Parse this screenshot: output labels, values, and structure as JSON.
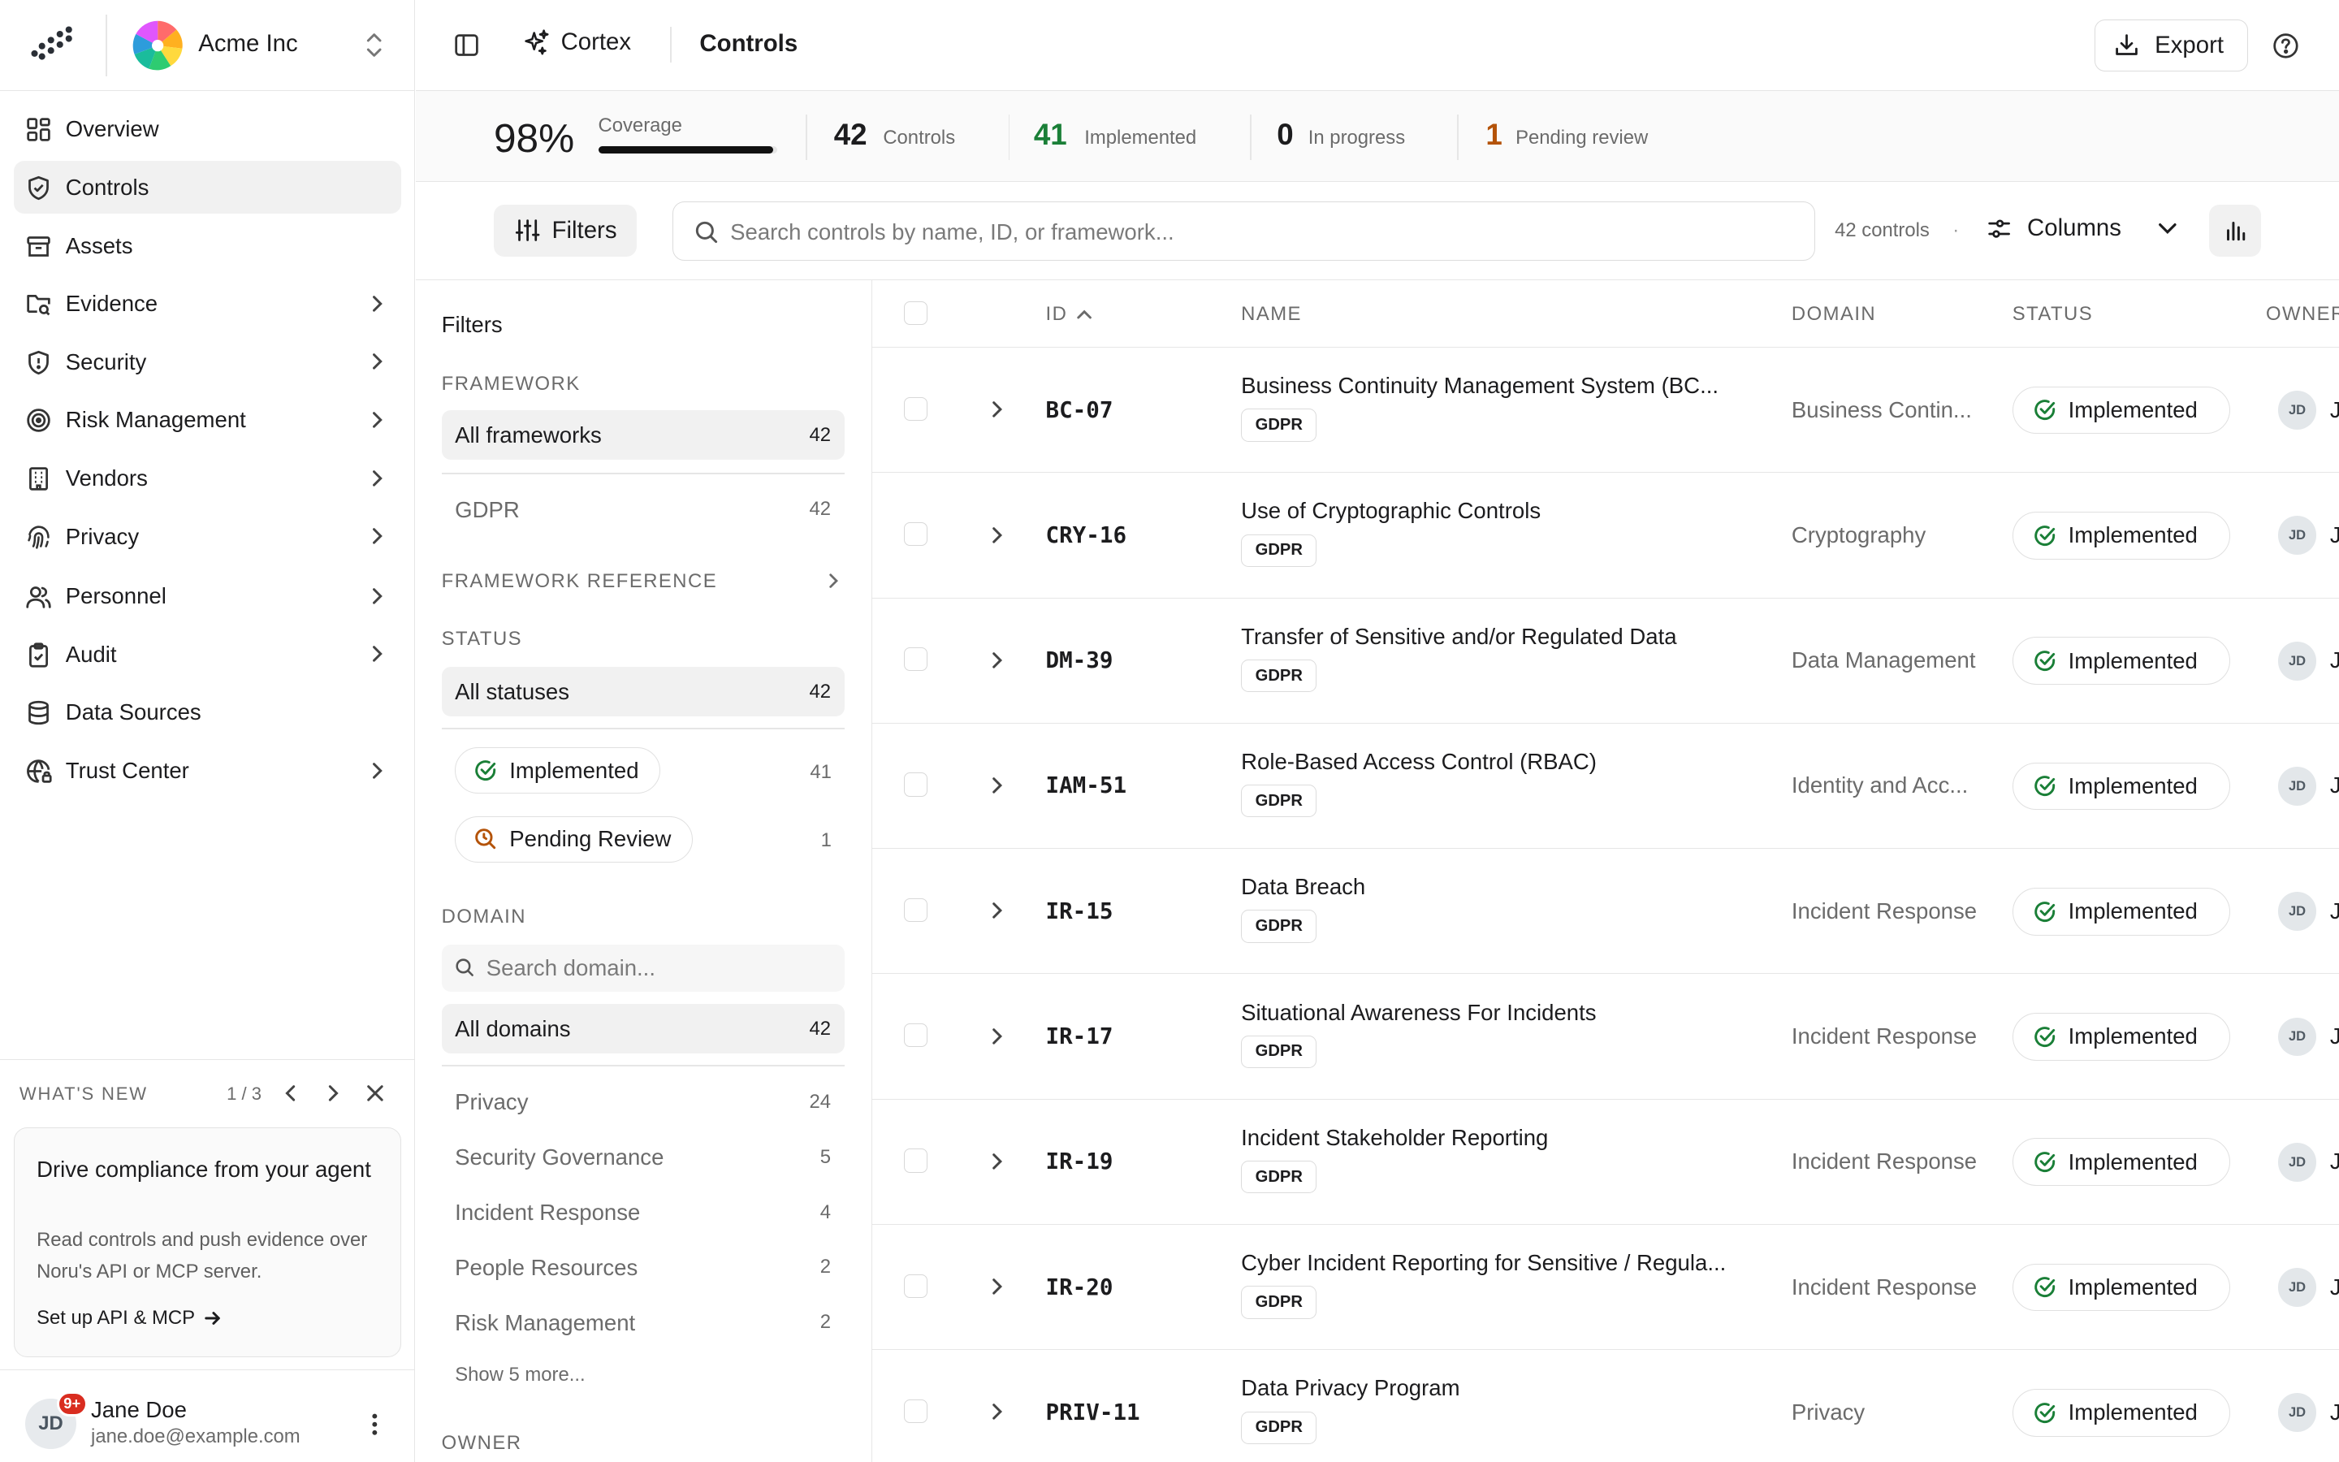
{
  "app": {
    "org_name": "Acme Inc",
    "assistant_label": "Cortex",
    "page_title": "Controls",
    "export_label": "Export",
    "accent_color": "#1a7f37",
    "pending_color": "#b45309"
  },
  "sidebar": {
    "items": [
      {
        "label": "Overview",
        "icon": "grid-icon",
        "has_children": false
      },
      {
        "label": "Controls",
        "icon": "shield-check-icon",
        "has_children": false,
        "active": true
      },
      {
        "label": "Assets",
        "icon": "archive-icon",
        "has_children": false
      },
      {
        "label": "Evidence",
        "icon": "folder-search-icon",
        "has_children": true
      },
      {
        "label": "Security",
        "icon": "shield-icon",
        "has_children": true
      },
      {
        "label": "Risk Management",
        "icon": "target-icon",
        "has_children": true
      },
      {
        "label": "Vendors",
        "icon": "building-icon",
        "has_children": true
      },
      {
        "label": "Privacy",
        "icon": "fingerprint-icon",
        "has_children": true
      },
      {
        "label": "Personnel",
        "icon": "users-icon",
        "has_children": true
      },
      {
        "label": "Audit",
        "icon": "clipboard-check-icon",
        "has_children": true
      },
      {
        "label": "Data Sources",
        "icon": "database-icon",
        "has_children": false
      },
      {
        "label": "Trust Center",
        "icon": "globe-lock-icon",
        "has_children": true
      }
    ],
    "whats_new": {
      "title": "WHAT'S NEW",
      "pager": "1 / 3",
      "card_title": "Drive compliance from your agent",
      "card_desc": "Read controls and push evidence over Noru's API or MCP server.",
      "card_link": "Set up API & MCP"
    },
    "user": {
      "initials": "JD",
      "badge": "9+",
      "name": "Jane Doe",
      "email": "jane.doe@example.com"
    }
  },
  "stats": {
    "coverage_pct": "98%",
    "coverage_label": "Coverage",
    "coverage_fraction": 0.98,
    "controls_num": "42",
    "controls_label": "Controls",
    "implemented_num": "41",
    "implemented_label": "Implemented",
    "in_progress_num": "0",
    "in_progress_label": "In progress",
    "pending_num": "1",
    "pending_label": "Pending review"
  },
  "toolbar": {
    "filters_label": "Filters",
    "search_placeholder": "Search controls by name, ID, or framework...",
    "count_label": "42 controls",
    "count_sep": "·",
    "columns_label": "Columns"
  },
  "filters": {
    "title": "Filters",
    "framework_title": "FRAMEWORK",
    "framework_all": {
      "label": "All frameworks",
      "count": "42"
    },
    "framework_gdpr": {
      "label": "GDPR",
      "count": "42"
    },
    "framework_ref_title": "FRAMEWORK REFERENCE",
    "status_title": "STATUS",
    "status_all": {
      "label": "All statuses",
      "count": "42"
    },
    "status_implemented": {
      "label": "Implemented",
      "count": "41"
    },
    "status_pending": {
      "label": "Pending Review",
      "count": "1"
    },
    "domain_title": "DOMAIN",
    "domain_search_placeholder": "Search domain...",
    "domain_all": {
      "label": "All domains",
      "count": "42"
    },
    "domains": [
      {
        "label": "Privacy",
        "count": "24"
      },
      {
        "label": "Security Governance",
        "count": "5"
      },
      {
        "label": "Incident Response",
        "count": "4"
      },
      {
        "label": "People Resources",
        "count": "2"
      },
      {
        "label": "Risk Management",
        "count": "2"
      }
    ],
    "show_more": "Show 5 more...",
    "owner_title": "OWNER"
  },
  "table": {
    "headers": {
      "id": "ID",
      "name": "NAME",
      "domain": "DOMAIN",
      "status": "STATUS",
      "owner": "OWNER"
    },
    "rows": [
      {
        "id": "BC-07",
        "name": "Business Continuity Management System (BC...",
        "tag": "GDPR",
        "domain": "Business Contin...",
        "status": "Implemented",
        "owner": "JD",
        "owner_name": "J"
      },
      {
        "id": "CRY-16",
        "name": "Use of Cryptographic Controls",
        "tag": "GDPR",
        "domain": "Cryptography",
        "status": "Implemented",
        "owner": "JD",
        "owner_name": "J"
      },
      {
        "id": "DM-39",
        "name": "Transfer of Sensitive and/or Regulated Data",
        "tag": "GDPR",
        "domain": "Data Management",
        "status": "Implemented",
        "owner": "JD",
        "owner_name": "J"
      },
      {
        "id": "IAM-51",
        "name": "Role-Based Access Control (RBAC)",
        "tag": "GDPR",
        "domain": "Identity and Acc...",
        "status": "Implemented",
        "owner": "JD",
        "owner_name": "J"
      },
      {
        "id": "IR-15",
        "name": "Data Breach",
        "tag": "GDPR",
        "domain": "Incident Response",
        "status": "Implemented",
        "owner": "JD",
        "owner_name": "J"
      },
      {
        "id": "IR-17",
        "name": "Situational Awareness For Incidents",
        "tag": "GDPR",
        "domain": "Incident Response",
        "status": "Implemented",
        "owner": "JD",
        "owner_name": "J"
      },
      {
        "id": "IR-19",
        "name": "Incident Stakeholder Reporting",
        "tag": "GDPR",
        "domain": "Incident Response",
        "status": "Implemented",
        "owner": "JD",
        "owner_name": "J"
      },
      {
        "id": "IR-20",
        "name": "Cyber Incident Reporting for Sensitive / Regula...",
        "tag": "GDPR",
        "domain": "Incident Response",
        "status": "Implemented",
        "owner": "JD",
        "owner_name": "J"
      },
      {
        "id": "PRIV-11",
        "name": "Data Privacy Program",
        "tag": "GDPR",
        "domain": "Privacy",
        "status": "Implemented",
        "owner": "JD",
        "owner_name": "J"
      }
    ]
  }
}
